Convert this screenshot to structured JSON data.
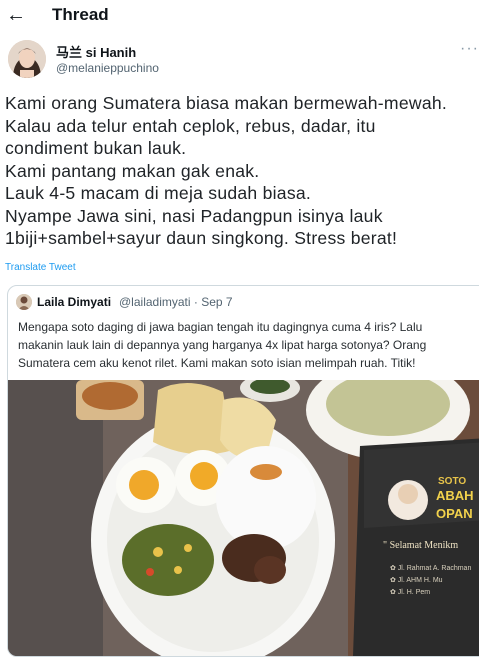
{
  "header": {
    "back_icon": "arrow-left-icon",
    "title": "Thread"
  },
  "tweet": {
    "author_name": "马兰 si Hanih",
    "author_handle": "@melanieppuchino",
    "more_icon": "more-dots-icon",
    "lines": [
      "Kami orang Sumatera biasa makan bermewah-mewah.",
      "Kalau ada telur entah ceplok, rebus, dadar, itu",
      "condiment bukan lauk.",
      "Kami pantang makan gak enak.",
      "Lauk 4-5 macam di meja sudah biasa.",
      "Nyampe Jawa sini, nasi Padangpun isinya lauk",
      "1biji+sambel+sayur daun singkong. Stress berat!"
    ],
    "translate_label": "Translate Tweet"
  },
  "quote": {
    "author_name": "Laila Dimyati",
    "author_handle": "@lailadimyati",
    "date": "· Sep 7",
    "lines": [
      "Mengapa soto daging di jawa bagian tengah itu dagingnya cuma 4 iris? Lalu",
      "makanin lauk lain di depannya yang harganya 4x lipat harga sotonya? Orang",
      "Sumatera cem aku kenot rilet. Kami makan soto isian melimpah ruah. Titik!"
    ],
    "photo": {
      "box_brand_top": "SOTO",
      "box_brand_name": "ABAH",
      "box_brand_name2": "OPAN",
      "box_tagline": "\" Selamat Menikm",
      "box_address_lines": [
        "✿ Jl. Rahmat A. Rachman",
        "✿ Jl. AHM H. Mu",
        "✿ Jl. H. Pem"
      ]
    }
  }
}
